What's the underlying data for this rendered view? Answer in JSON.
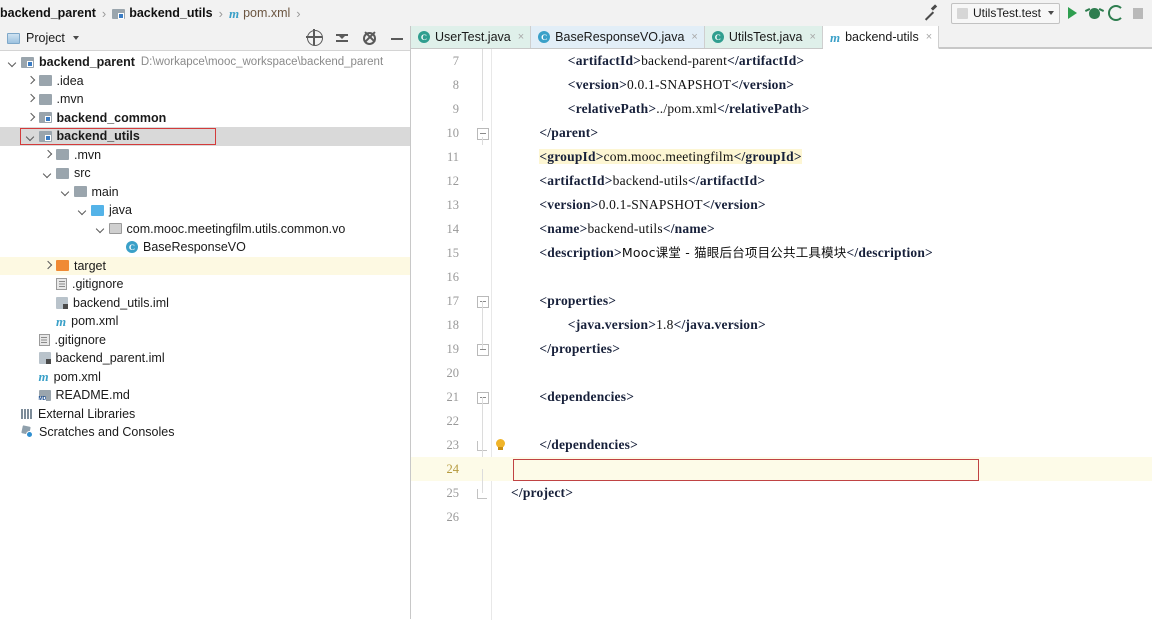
{
  "breadcrumb": {
    "items": [
      {
        "label": "backend_parent",
        "icon": "module-icon",
        "style": "bold"
      },
      {
        "label": "backend_utils",
        "icon": "module-icon",
        "style": "bold"
      },
      {
        "label": "pom.xml",
        "icon": "maven-icon",
        "style": "plain"
      }
    ]
  },
  "toolbar": {
    "build_icon": "hammer-icon",
    "run_config": "UtilsTest.test",
    "run_icon": "run-icon",
    "debug_icon": "debug-icon",
    "coverage_icon": "run-with-coverage-icon",
    "stop_icon": "stop-icon"
  },
  "project_panel": {
    "title": "Project",
    "tools": [
      "locate-icon",
      "collapse-all-icon",
      "settings-gear-icon",
      "hide-icon"
    ],
    "tree": [
      {
        "label": "backend_parent",
        "path": "D:\\workapce\\mooc_workspace\\backend_parent",
        "indent": 0,
        "arrow": "down",
        "icon": "module-icon",
        "bold": true
      },
      {
        "label": ".idea",
        "indent": 1,
        "arrow": "right",
        "icon": "folder-gray"
      },
      {
        "label": ".mvn",
        "indent": 1,
        "arrow": "right",
        "icon": "folder-gray"
      },
      {
        "label": "backend_common",
        "indent": 1,
        "arrow": "right",
        "icon": "module-icon",
        "bold": true
      },
      {
        "label": "backend_utils",
        "indent": 1,
        "arrow": "down",
        "icon": "module-icon",
        "bold": true,
        "selected": true,
        "annotated": true
      },
      {
        "label": ".mvn",
        "indent": 2,
        "arrow": "right",
        "icon": "folder-gray"
      },
      {
        "label": "src",
        "indent": 2,
        "arrow": "down",
        "icon": "folder-gray"
      },
      {
        "label": "main",
        "indent": 3,
        "arrow": "down",
        "icon": "folder-gray"
      },
      {
        "label": "java",
        "indent": 4,
        "arrow": "down",
        "icon": "folder-source-blue"
      },
      {
        "label": "com.mooc.meetingfilm.utils.common.vo",
        "indent": 5,
        "arrow": "down",
        "icon": "package-icon"
      },
      {
        "label": "BaseResponseVO",
        "indent": 6,
        "arrow": "none",
        "icon": "class-icon"
      },
      {
        "label": "target",
        "indent": 2,
        "arrow": "right",
        "icon": "folder-excluded-orange",
        "excluded": true
      },
      {
        "label": ".gitignore",
        "indent": 2,
        "arrow": "none",
        "icon": "file-icon"
      },
      {
        "label": "backend_utils.iml",
        "indent": 2,
        "arrow": "none",
        "icon": "iml-icon"
      },
      {
        "label": "pom.xml",
        "indent": 2,
        "arrow": "none",
        "icon": "maven-icon"
      },
      {
        "label": ".gitignore",
        "indent": 1,
        "arrow": "none",
        "icon": "file-icon"
      },
      {
        "label": "backend_parent.iml",
        "indent": 1,
        "arrow": "none",
        "icon": "iml-icon"
      },
      {
        "label": "pom.xml",
        "indent": 1,
        "arrow": "none",
        "icon": "maven-icon"
      },
      {
        "label": "README.md",
        "indent": 1,
        "arrow": "none",
        "icon": "markdown-icon"
      },
      {
        "label": "External Libraries",
        "indent": 0,
        "arrow": "none",
        "icon": "library-icon"
      },
      {
        "label": "Scratches and Consoles",
        "indent": 0,
        "arrow": "none",
        "icon": "scratches-icon"
      }
    ]
  },
  "editor": {
    "tabs": [
      {
        "label": "UserTest.java",
        "icon": "test-class-icon",
        "active": false,
        "style": "t1"
      },
      {
        "label": "BaseResponseVO.java",
        "icon": "class-icon",
        "active": false,
        "style": "t2"
      },
      {
        "label": "UtilsTest.java",
        "icon": "test-class-icon",
        "active": false,
        "style": "t3"
      },
      {
        "label": "backend-utils",
        "icon": "maven-icon",
        "active": true,
        "style": "active"
      }
    ],
    "first_line": 7,
    "last_line": 26,
    "caret_line": 24,
    "highlighted_line": 11,
    "lines": [
      {
        "n": 7,
        "indent": 4,
        "segments": [
          {
            "t": "tag",
            "v": "<artifactId>"
          },
          {
            "t": "val",
            "v": "backend-parent"
          },
          {
            "t": "tag",
            "v": "</artifactId>"
          }
        ]
      },
      {
        "n": 8,
        "indent": 4,
        "segments": [
          {
            "t": "tag",
            "v": "<version>"
          },
          {
            "t": "val",
            "v": "0.0.1-SNAPSHOT"
          },
          {
            "t": "tag",
            "v": "</version>"
          }
        ]
      },
      {
        "n": 9,
        "indent": 4,
        "segments": [
          {
            "t": "tag",
            "v": "<relativePath>"
          },
          {
            "t": "val",
            "v": "../pom.xml"
          },
          {
            "t": "tag",
            "v": "</relativePath>"
          }
        ]
      },
      {
        "n": 10,
        "indent": 2,
        "fold": "minus",
        "segments": [
          {
            "t": "tag",
            "v": "</parent>"
          }
        ]
      },
      {
        "n": 11,
        "indent": 2,
        "highlight": true,
        "segments": [
          {
            "t": "tag",
            "v": "<groupId>"
          },
          {
            "t": "val",
            "v": "com.mooc.meetingfilm"
          },
          {
            "t": "tag",
            "v": "</groupId>"
          }
        ]
      },
      {
        "n": 12,
        "indent": 2,
        "segments": [
          {
            "t": "tag",
            "v": "<artifactId>"
          },
          {
            "t": "val",
            "v": "backend-utils"
          },
          {
            "t": "tag",
            "v": "</artifactId>"
          }
        ]
      },
      {
        "n": 13,
        "indent": 2,
        "segments": [
          {
            "t": "tag",
            "v": "<version>"
          },
          {
            "t": "val",
            "v": "0.0.1-SNAPSHOT"
          },
          {
            "t": "tag",
            "v": "</version>"
          }
        ]
      },
      {
        "n": 14,
        "indent": 2,
        "segments": [
          {
            "t": "tag",
            "v": "<name>"
          },
          {
            "t": "val",
            "v": "backend-utils"
          },
          {
            "t": "tag",
            "v": "</name>"
          }
        ]
      },
      {
        "n": 15,
        "indent": 2,
        "segments": [
          {
            "t": "tag",
            "v": "<description>"
          },
          {
            "t": "cjk",
            "v": "Mooc课堂 - 猫眼后台项目公共工具模块"
          },
          {
            "t": "tag",
            "v": "</description>"
          }
        ]
      },
      {
        "n": 16,
        "indent": 2,
        "segments": []
      },
      {
        "n": 17,
        "indent": 2,
        "fold": "minus",
        "segments": [
          {
            "t": "tag",
            "v": "<properties>"
          }
        ]
      },
      {
        "n": 18,
        "indent": 4,
        "segments": [
          {
            "t": "tag",
            "v": "<java.version>"
          },
          {
            "t": "val",
            "v": "1.8"
          },
          {
            "t": "tag",
            "v": "</java.version>"
          }
        ]
      },
      {
        "n": 19,
        "indent": 2,
        "fold": "minus",
        "segments": [
          {
            "t": "tag",
            "v": "</properties>"
          }
        ]
      },
      {
        "n": 20,
        "indent": 2,
        "segments": []
      },
      {
        "n": 21,
        "indent": 2,
        "fold": "minus",
        "segments": [
          {
            "t": "tag",
            "v": "<dependencies>"
          }
        ]
      },
      {
        "n": 22,
        "indent": 2,
        "segments": []
      },
      {
        "n": 23,
        "indent": 2,
        "fold": "end",
        "bulb": true,
        "segments": [
          {
            "t": "tag",
            "v": "</dependencies>"
          }
        ]
      },
      {
        "n": 24,
        "indent": 2,
        "caret": true,
        "segments": []
      },
      {
        "n": 25,
        "indent": 0,
        "fold": "end",
        "segments": [
          {
            "t": "tag",
            "v": "</project>"
          }
        ]
      },
      {
        "n": 26,
        "indent": 0,
        "segments": []
      }
    ]
  }
}
